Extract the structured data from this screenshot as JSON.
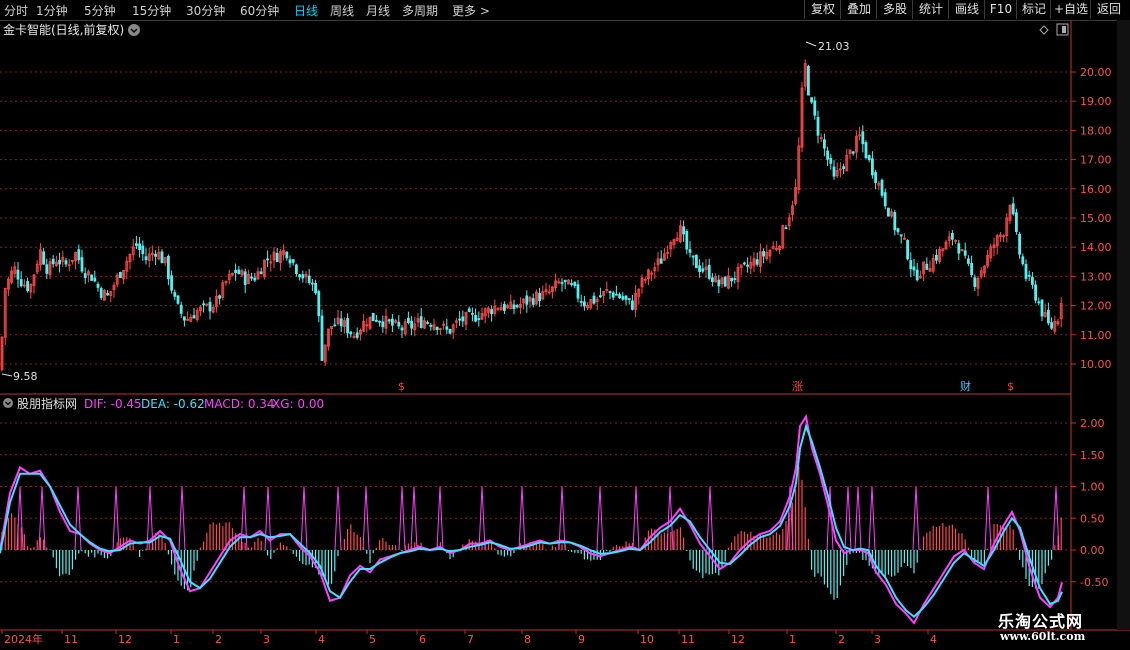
{
  "toolbar": {
    "periods": [
      "分时",
      "1分钟",
      "5分钟",
      "15分钟",
      "30分钟",
      "60分钟",
      "日线",
      "周线",
      "月线",
      "多周期",
      "更多 >"
    ],
    "active_period": "日线",
    "buttons": [
      "复权",
      "叠加",
      "多股",
      "统计",
      "画线",
      "F10",
      "标记",
      "+自选",
      "返回"
    ]
  },
  "main_chart": {
    "title": "金卡智能(日线,前复权)",
    "high_label": "21.03",
    "low_label": "9.58",
    "y_ticks": [
      "20.00",
      "19.00",
      "18.00",
      "17.00",
      "16.00",
      "15.00",
      "14.00",
      "13.00",
      "12.00",
      "11.00",
      "10.00"
    ],
    "markers": [
      {
        "text": "$",
        "color": "#ff4040"
      },
      {
        "text": "涨",
        "color": "#ff4040"
      },
      {
        "text": "财",
        "color": "#40c8ff"
      },
      {
        "text": "$",
        "color": "#ff4040"
      }
    ]
  },
  "indicator": {
    "name": "股朋指标网",
    "dif_label": "DIF: -0.45",
    "dea_label": "DEA: -0.62",
    "macd_label": "MACD: 0.34",
    "xg_label": "XG: 0.00",
    "y_ticks": [
      "2.00",
      "1.50",
      "1.00",
      "0.50",
      "0.00",
      "-0.50"
    ]
  },
  "x_axis": {
    "labels": [
      "2024年",
      "11",
      "12",
      "1",
      "2",
      "3",
      "4",
      "5",
      "6",
      "7",
      "8",
      "9",
      "10",
      "11",
      "12",
      "1",
      "2",
      "3",
      "4"
    ]
  },
  "watermark": {
    "line1": "乐淘公式网",
    "line2": "www.60lt.com"
  },
  "colors": {
    "up": "#ff4a4a",
    "down": "#54f0f0",
    "dif": "#ff40ff",
    "dea": "#40e0ff",
    "xg": "#ff40ff",
    "axis": "#c03030",
    "active": "#00d2ff"
  },
  "chart_data": {
    "type": "candlestick",
    "price_range": [
      9.5,
      21.5
    ],
    "close_series": [
      [
        0,
        9.8
      ],
      [
        5,
        12.6
      ],
      [
        14,
        13.3
      ],
      [
        22,
        12.8
      ],
      [
        30,
        12.6
      ],
      [
        40,
        13.9
      ],
      [
        48,
        13.2
      ],
      [
        56,
        13.6
      ],
      [
        66,
        13.4
      ],
      [
        76,
        13.8
      ],
      [
        84,
        13.2
      ],
      [
        92,
        13.0
      ],
      [
        100,
        12.5
      ],
      [
        108,
        12.3
      ],
      [
        118,
        13.0
      ],
      [
        126,
        13.5
      ],
      [
        136,
        14.1
      ],
      [
        146,
        13.6
      ],
      [
        156,
        13.9
      ],
      [
        166,
        13.4
      ],
      [
        176,
        12.0
      ],
      [
        186,
        11.5
      ],
      [
        196,
        11.8
      ],
      [
        206,
        11.9
      ],
      [
        216,
        12.1
      ],
      [
        226,
        12.8
      ],
      [
        236,
        13.2
      ],
      [
        246,
        12.9
      ],
      [
        256,
        13.0
      ],
      [
        266,
        13.6
      ],
      [
        276,
        13.7
      ],
      [
        286,
        13.9
      ],
      [
        296,
        13.3
      ],
      [
        306,
        12.9
      ],
      [
        316,
        12.6
      ],
      [
        322,
        10.3
      ],
      [
        330,
        11.3
      ],
      [
        342,
        11.4
      ],
      [
        354,
        11.0
      ],
      [
        366,
        11.5
      ],
      [
        376,
        11.6
      ],
      [
        388,
        11.4
      ],
      [
        400,
        11.2
      ],
      [
        412,
        11.3
      ],
      [
        424,
        11.5
      ],
      [
        436,
        11.4
      ],
      [
        448,
        11.1
      ],
      [
        460,
        11.5
      ],
      [
        472,
        11.6
      ],
      [
        486,
        11.8
      ],
      [
        498,
        12.0
      ],
      [
        512,
        11.9
      ],
      [
        524,
        12.1
      ],
      [
        536,
        12.3
      ],
      [
        548,
        12.4
      ],
      [
        560,
        12.8
      ],
      [
        572,
        12.6
      ],
      [
        584,
        12.1
      ],
      [
        596,
        12.2
      ],
      [
        608,
        12.5
      ],
      [
        620,
        12.3
      ],
      [
        632,
        12.0
      ],
      [
        640,
        12.7
      ],
      [
        652,
        13.2
      ],
      [
        662,
        13.6
      ],
      [
        672,
        14.4
      ],
      [
        680,
        14.6
      ],
      [
        690,
        13.6
      ],
      [
        700,
        13.3
      ],
      [
        710,
        13.1
      ],
      [
        718,
        12.7
      ],
      [
        730,
        12.9
      ],
      [
        742,
        13.2
      ],
      [
        754,
        13.5
      ],
      [
        766,
        13.8
      ],
      [
        778,
        14.1
      ],
      [
        788,
        15.0
      ],
      [
        796,
        16.0
      ],
      [
        800,
        18.0
      ],
      [
        804,
        20.5
      ],
      [
        810,
        19.0
      ],
      [
        818,
        18.0
      ],
      [
        826,
        17.2
      ],
      [
        834,
        16.3
      ],
      [
        842,
        16.8
      ],
      [
        850,
        17.2
      ],
      [
        860,
        17.8
      ],
      [
        868,
        17.0
      ],
      [
        876,
        16.4
      ],
      [
        886,
        15.5
      ],
      [
        896,
        14.6
      ],
      [
        906,
        14.0
      ],
      [
        914,
        13.0
      ],
      [
        924,
        13.3
      ],
      [
        934,
        13.6
      ],
      [
        944,
        14.0
      ],
      [
        954,
        14.4
      ],
      [
        964,
        13.6
      ],
      [
        974,
        12.8
      ],
      [
        984,
        13.4
      ],
      [
        994,
        14.1
      ],
      [
        1004,
        14.6
      ],
      [
        1010,
        15.6
      ],
      [
        1018,
        14.0
      ],
      [
        1026,
        13.0
      ],
      [
        1034,
        12.5
      ],
      [
        1042,
        11.8
      ],
      [
        1050,
        11.2
      ],
      [
        1058,
        11.6
      ],
      [
        1063,
        12.6
      ]
    ],
    "dif_series": [
      [
        0,
        0.0
      ],
      [
        10,
        0.9
      ],
      [
        20,
        1.3
      ],
      [
        30,
        1.2
      ],
      [
        40,
        1.25
      ],
      [
        50,
        1.0
      ],
      [
        60,
        0.6
      ],
      [
        70,
        0.3
      ],
      [
        80,
        0.25
      ],
      [
        90,
        0.1
      ],
      [
        100,
        0.0
      ],
      [
        110,
        -0.05
      ],
      [
        120,
        0.05
      ],
      [
        130,
        0.15
      ],
      [
        140,
        0.1
      ],
      [
        150,
        0.15
      ],
      [
        160,
        0.3
      ],
      [
        170,
        0.15
      ],
      [
        180,
        -0.3
      ],
      [
        190,
        -0.65
      ],
      [
        200,
        -0.6
      ],
      [
        210,
        -0.35
      ],
      [
        220,
        -0.1
      ],
      [
        230,
        0.15
      ],
      [
        240,
        0.25
      ],
      [
        250,
        0.2
      ],
      [
        260,
        0.3
      ],
      [
        270,
        0.15
      ],
      [
        280,
        0.25
      ],
      [
        290,
        0.25
      ],
      [
        300,
        0.05
      ],
      [
        310,
        -0.1
      ],
      [
        320,
        -0.35
      ],
      [
        330,
        -0.8
      ],
      [
        340,
        -0.75
      ],
      [
        350,
        -0.4
      ],
      [
        360,
        -0.25
      ],
      [
        370,
        -0.35
      ],
      [
        380,
        -0.15
      ],
      [
        390,
        -0.1
      ],
      [
        400,
        -0.05
      ],
      [
        410,
        0.0
      ],
      [
        420,
        0.05
      ],
      [
        430,
        0.0
      ],
      [
        440,
        0.05
      ],
      [
        450,
        -0.05
      ],
      [
        460,
        0.0
      ],
      [
        470,
        0.1
      ],
      [
        480,
        0.1
      ],
      [
        490,
        0.15
      ],
      [
        500,
        0.05
      ],
      [
        510,
        0.0
      ],
      [
        520,
        0.05
      ],
      [
        530,
        0.1
      ],
      [
        540,
        0.15
      ],
      [
        550,
        0.1
      ],
      [
        560,
        0.15
      ],
      [
        570,
        0.12
      ],
      [
        580,
        0.05
      ],
      [
        590,
        -0.05
      ],
      [
        600,
        -0.1
      ],
      [
        610,
        -0.05
      ],
      [
        620,
        0.0
      ],
      [
        630,
        0.05
      ],
      [
        640,
        0.0
      ],
      [
        650,
        0.2
      ],
      [
        660,
        0.35
      ],
      [
        670,
        0.45
      ],
      [
        680,
        0.65
      ],
      [
        690,
        0.4
      ],
      [
        700,
        0.1
      ],
      [
        710,
        -0.1
      ],
      [
        720,
        -0.3
      ],
      [
        730,
        -0.2
      ],
      [
        740,
        0.0
      ],
      [
        750,
        0.15
      ],
      [
        760,
        0.25
      ],
      [
        770,
        0.3
      ],
      [
        780,
        0.45
      ],
      [
        790,
        0.85
      ],
      [
        796,
        1.3
      ],
      [
        800,
        1.95
      ],
      [
        806,
        2.1
      ],
      [
        812,
        1.6
      ],
      [
        820,
        1.2
      ],
      [
        828,
        0.7
      ],
      [
        836,
        0.15
      ],
      [
        844,
        -0.05
      ],
      [
        852,
        0.0
      ],
      [
        860,
        0.0
      ],
      [
        868,
        -0.05
      ],
      [
        876,
        -0.35
      ],
      [
        886,
        -0.55
      ],
      [
        896,
        -0.85
      ],
      [
        906,
        -1.0
      ],
      [
        914,
        -1.15
      ],
      [
        924,
        -0.85
      ],
      [
        934,
        -0.6
      ],
      [
        944,
        -0.35
      ],
      [
        954,
        -0.1
      ],
      [
        964,
        0.0
      ],
      [
        974,
        -0.2
      ],
      [
        984,
        -0.3
      ],
      [
        994,
        0.1
      ],
      [
        1004,
        0.4
      ],
      [
        1012,
        0.6
      ],
      [
        1020,
        0.3
      ],
      [
        1030,
        -0.3
      ],
      [
        1040,
        -0.75
      ],
      [
        1050,
        -0.9
      ],
      [
        1058,
        -0.75
      ],
      [
        1063,
        -0.45
      ]
    ],
    "dea_series": [
      [
        0,
        -0.05
      ],
      [
        10,
        0.75
      ],
      [
        20,
        1.2
      ],
      [
        30,
        1.2
      ],
      [
        40,
        1.2
      ],
      [
        50,
        1.0
      ],
      [
        60,
        0.7
      ],
      [
        70,
        0.4
      ],
      [
        80,
        0.25
      ],
      [
        90,
        0.12
      ],
      [
        100,
        0.02
      ],
      [
        110,
        -0.02
      ],
      [
        120,
        0.0
      ],
      [
        130,
        0.1
      ],
      [
        140,
        0.12
      ],
      [
        150,
        0.12
      ],
      [
        160,
        0.22
      ],
      [
        170,
        0.18
      ],
      [
        180,
        -0.15
      ],
      [
        190,
        -0.5
      ],
      [
        200,
        -0.6
      ],
      [
        210,
        -0.45
      ],
      [
        220,
        -0.2
      ],
      [
        230,
        0.05
      ],
      [
        240,
        0.2
      ],
      [
        250,
        0.2
      ],
      [
        260,
        0.25
      ],
      [
        270,
        0.2
      ],
      [
        280,
        0.22
      ],
      [
        290,
        0.25
      ],
      [
        300,
        0.1
      ],
      [
        310,
        -0.05
      ],
      [
        320,
        -0.25
      ],
      [
        330,
        -0.65
      ],
      [
        340,
        -0.75
      ],
      [
        350,
        -0.5
      ],
      [
        360,
        -0.3
      ],
      [
        370,
        -0.3
      ],
      [
        380,
        -0.2
      ],
      [
        390,
        -0.12
      ],
      [
        400,
        -0.05
      ],
      [
        410,
        -0.02
      ],
      [
        420,
        0.02
      ],
      [
        430,
        0.0
      ],
      [
        440,
        0.02
      ],
      [
        450,
        -0.02
      ],
      [
        460,
        0.0
      ],
      [
        470,
        0.05
      ],
      [
        480,
        0.08
      ],
      [
        490,
        0.12
      ],
      [
        500,
        0.08
      ],
      [
        510,
        0.02
      ],
      [
        520,
        0.03
      ],
      [
        530,
        0.07
      ],
      [
        540,
        0.12
      ],
      [
        550,
        0.1
      ],
      [
        560,
        0.12
      ],
      [
        570,
        0.12
      ],
      [
        580,
        0.07
      ],
      [
        590,
        0.0
      ],
      [
        600,
        -0.06
      ],
      [
        610,
        -0.05
      ],
      [
        620,
        -0.02
      ],
      [
        630,
        0.02
      ],
      [
        640,
        0.0
      ],
      [
        650,
        0.12
      ],
      [
        660,
        0.28
      ],
      [
        670,
        0.38
      ],
      [
        680,
        0.55
      ],
      [
        690,
        0.45
      ],
      [
        700,
        0.2
      ],
      [
        710,
        0.0
      ],
      [
        720,
        -0.2
      ],
      [
        730,
        -0.22
      ],
      [
        740,
        -0.08
      ],
      [
        750,
        0.08
      ],
      [
        760,
        0.2
      ],
      [
        770,
        0.25
      ],
      [
        780,
        0.38
      ],
      [
        790,
        0.7
      ],
      [
        796,
        1.05
      ],
      [
        800,
        1.6
      ],
      [
        806,
        1.95
      ],
      [
        812,
        1.7
      ],
      [
        820,
        1.3
      ],
      [
        828,
        0.85
      ],
      [
        836,
        0.35
      ],
      [
        844,
        0.05
      ],
      [
        852,
        0.0
      ],
      [
        860,
        0.02
      ],
      [
        868,
        0.0
      ],
      [
        876,
        -0.25
      ],
      [
        886,
        -0.45
      ],
      [
        896,
        -0.75
      ],
      [
        906,
        -0.95
      ],
      [
        914,
        -1.05
      ],
      [
        924,
        -0.9
      ],
      [
        934,
        -0.7
      ],
      [
        944,
        -0.45
      ],
      [
        954,
        -0.2
      ],
      [
        964,
        -0.05
      ],
      [
        974,
        -0.15
      ],
      [
        984,
        -0.25
      ],
      [
        994,
        0.0
      ],
      [
        1004,
        0.3
      ],
      [
        1012,
        0.5
      ],
      [
        1020,
        0.35
      ],
      [
        1030,
        -0.15
      ],
      [
        1040,
        -0.6
      ],
      [
        1050,
        -0.85
      ],
      [
        1058,
        -0.8
      ],
      [
        1063,
        -0.62
      ]
    ],
    "xg_spikes_x": [
      20,
      42,
      78,
      116,
      150,
      182,
      244,
      268,
      304,
      338,
      366,
      402,
      414,
      440,
      482,
      522,
      562,
      600,
      636,
      670,
      710,
      790,
      830,
      848,
      858,
      872,
      916,
      988,
      1056
    ]
  }
}
